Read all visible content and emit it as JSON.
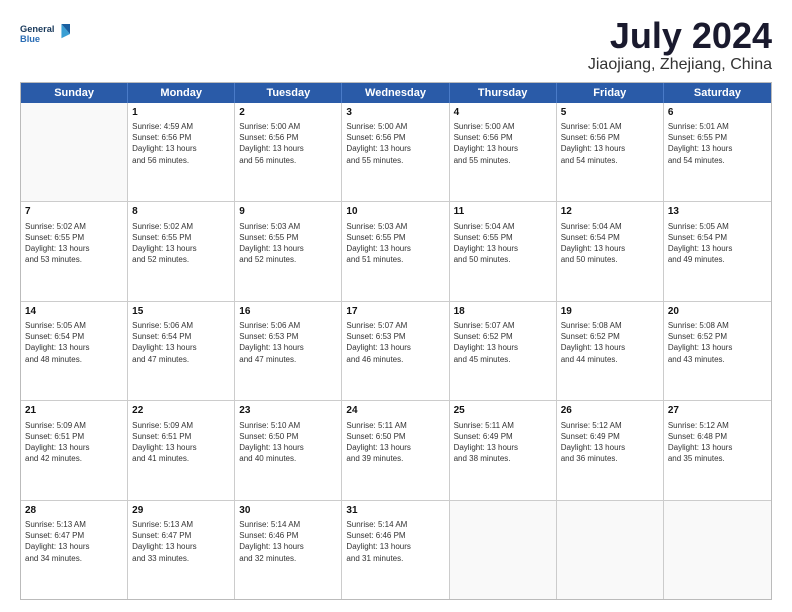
{
  "logo": {
    "text_general": "General",
    "text_blue": "Blue"
  },
  "title": {
    "main": "July 2024",
    "sub": "Jiaojiang, Zhejiang, China"
  },
  "header_days": [
    "Sunday",
    "Monday",
    "Tuesday",
    "Wednesday",
    "Thursday",
    "Friday",
    "Saturday"
  ],
  "weeks": [
    [
      {
        "day": "",
        "info": ""
      },
      {
        "day": "1",
        "info": "Sunrise: 4:59 AM\nSunset: 6:56 PM\nDaylight: 13 hours\nand 56 minutes."
      },
      {
        "day": "2",
        "info": "Sunrise: 5:00 AM\nSunset: 6:56 PM\nDaylight: 13 hours\nand 56 minutes."
      },
      {
        "day": "3",
        "info": "Sunrise: 5:00 AM\nSunset: 6:56 PM\nDaylight: 13 hours\nand 55 minutes."
      },
      {
        "day": "4",
        "info": "Sunrise: 5:00 AM\nSunset: 6:56 PM\nDaylight: 13 hours\nand 55 minutes."
      },
      {
        "day": "5",
        "info": "Sunrise: 5:01 AM\nSunset: 6:56 PM\nDaylight: 13 hours\nand 54 minutes."
      },
      {
        "day": "6",
        "info": "Sunrise: 5:01 AM\nSunset: 6:55 PM\nDaylight: 13 hours\nand 54 minutes."
      }
    ],
    [
      {
        "day": "7",
        "info": "Sunrise: 5:02 AM\nSunset: 6:55 PM\nDaylight: 13 hours\nand 53 minutes."
      },
      {
        "day": "8",
        "info": "Sunrise: 5:02 AM\nSunset: 6:55 PM\nDaylight: 13 hours\nand 52 minutes."
      },
      {
        "day": "9",
        "info": "Sunrise: 5:03 AM\nSunset: 6:55 PM\nDaylight: 13 hours\nand 52 minutes."
      },
      {
        "day": "10",
        "info": "Sunrise: 5:03 AM\nSunset: 6:55 PM\nDaylight: 13 hours\nand 51 minutes."
      },
      {
        "day": "11",
        "info": "Sunrise: 5:04 AM\nSunset: 6:55 PM\nDaylight: 13 hours\nand 50 minutes."
      },
      {
        "day": "12",
        "info": "Sunrise: 5:04 AM\nSunset: 6:54 PM\nDaylight: 13 hours\nand 50 minutes."
      },
      {
        "day": "13",
        "info": "Sunrise: 5:05 AM\nSunset: 6:54 PM\nDaylight: 13 hours\nand 49 minutes."
      }
    ],
    [
      {
        "day": "14",
        "info": "Sunrise: 5:05 AM\nSunset: 6:54 PM\nDaylight: 13 hours\nand 48 minutes."
      },
      {
        "day": "15",
        "info": "Sunrise: 5:06 AM\nSunset: 6:54 PM\nDaylight: 13 hours\nand 47 minutes."
      },
      {
        "day": "16",
        "info": "Sunrise: 5:06 AM\nSunset: 6:53 PM\nDaylight: 13 hours\nand 47 minutes."
      },
      {
        "day": "17",
        "info": "Sunrise: 5:07 AM\nSunset: 6:53 PM\nDaylight: 13 hours\nand 46 minutes."
      },
      {
        "day": "18",
        "info": "Sunrise: 5:07 AM\nSunset: 6:52 PM\nDaylight: 13 hours\nand 45 minutes."
      },
      {
        "day": "19",
        "info": "Sunrise: 5:08 AM\nSunset: 6:52 PM\nDaylight: 13 hours\nand 44 minutes."
      },
      {
        "day": "20",
        "info": "Sunrise: 5:08 AM\nSunset: 6:52 PM\nDaylight: 13 hours\nand 43 minutes."
      }
    ],
    [
      {
        "day": "21",
        "info": "Sunrise: 5:09 AM\nSunset: 6:51 PM\nDaylight: 13 hours\nand 42 minutes."
      },
      {
        "day": "22",
        "info": "Sunrise: 5:09 AM\nSunset: 6:51 PM\nDaylight: 13 hours\nand 41 minutes."
      },
      {
        "day": "23",
        "info": "Sunrise: 5:10 AM\nSunset: 6:50 PM\nDaylight: 13 hours\nand 40 minutes."
      },
      {
        "day": "24",
        "info": "Sunrise: 5:11 AM\nSunset: 6:50 PM\nDaylight: 13 hours\nand 39 minutes."
      },
      {
        "day": "25",
        "info": "Sunrise: 5:11 AM\nSunset: 6:49 PM\nDaylight: 13 hours\nand 38 minutes."
      },
      {
        "day": "26",
        "info": "Sunrise: 5:12 AM\nSunset: 6:49 PM\nDaylight: 13 hours\nand 36 minutes."
      },
      {
        "day": "27",
        "info": "Sunrise: 5:12 AM\nSunset: 6:48 PM\nDaylight: 13 hours\nand 35 minutes."
      }
    ],
    [
      {
        "day": "28",
        "info": "Sunrise: 5:13 AM\nSunset: 6:47 PM\nDaylight: 13 hours\nand 34 minutes."
      },
      {
        "day": "29",
        "info": "Sunrise: 5:13 AM\nSunset: 6:47 PM\nDaylight: 13 hours\nand 33 minutes."
      },
      {
        "day": "30",
        "info": "Sunrise: 5:14 AM\nSunset: 6:46 PM\nDaylight: 13 hours\nand 32 minutes."
      },
      {
        "day": "31",
        "info": "Sunrise: 5:14 AM\nSunset: 6:46 PM\nDaylight: 13 hours\nand 31 minutes."
      },
      {
        "day": "",
        "info": ""
      },
      {
        "day": "",
        "info": ""
      },
      {
        "day": "",
        "info": ""
      }
    ]
  ]
}
